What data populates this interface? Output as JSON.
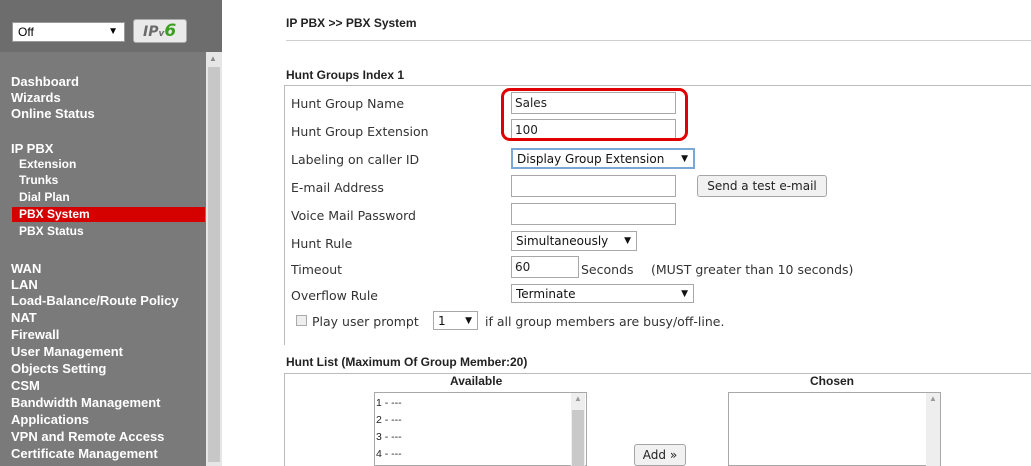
{
  "sidebar": {
    "mode_select": "Off",
    "ipv6_badge": {
      "prefix": "IP",
      "sub": "v",
      "num": "6"
    },
    "menu": [
      {
        "label": "Dashboard",
        "level": 1
      },
      {
        "label": "Wizards",
        "level": 1
      },
      {
        "label": "Online Status",
        "level": 1
      },
      {
        "label": "IP PBX",
        "level": 1
      },
      {
        "label": "Extension",
        "level": 2
      },
      {
        "label": "Trunks",
        "level": 2
      },
      {
        "label": "Dial Plan",
        "level": 2
      },
      {
        "label": "PBX System",
        "level": 2,
        "active": true
      },
      {
        "label": "PBX Status",
        "level": 2
      },
      {
        "label": "WAN",
        "level": 1
      },
      {
        "label": "LAN",
        "level": 1
      },
      {
        "label": "Load-Balance/Route Policy",
        "level": 1
      },
      {
        "label": "NAT",
        "level": 1
      },
      {
        "label": "Firewall",
        "level": 1
      },
      {
        "label": "User Management",
        "level": 1
      },
      {
        "label": "Objects Setting",
        "level": 1
      },
      {
        "label": "CSM",
        "level": 1
      },
      {
        "label": "Bandwidth Management",
        "level": 1
      },
      {
        "label": "Applications",
        "level": 1
      },
      {
        "label": "VPN and Remote Access",
        "level": 1
      },
      {
        "label": "Certificate Management",
        "level": 1
      }
    ]
  },
  "breadcrumb": "IP PBX >> PBX System",
  "section_title": "Hunt Groups Index 1",
  "form": {
    "group_name": {
      "label": "Hunt Group Name",
      "value": "Sales"
    },
    "group_extension": {
      "label": "Hunt Group Extension",
      "value": "100"
    },
    "labeling": {
      "label": "Labeling on caller ID",
      "value": "Display Group Extension"
    },
    "email": {
      "label": "E-mail Address",
      "value": "",
      "button": "Send a test e-mail"
    },
    "voicemail_password": {
      "label": "Voice Mail Password",
      "value": ""
    },
    "hunt_rule": {
      "label": "Hunt Rule",
      "value": "Simultaneously"
    },
    "timeout": {
      "label": "Timeout",
      "value": "60",
      "unit": "Seconds",
      "note": "(MUST greater than 10 seconds)"
    },
    "overflow_rule": {
      "label": "Overflow Rule",
      "value": "Terminate"
    },
    "play_prompt": {
      "text_before": "Play user prompt",
      "value": "1",
      "text_after": "if all group members are busy/off-line.",
      "checked": false
    }
  },
  "hunt_list": {
    "title": "Hunt List (Maximum Of Group Member:20)",
    "available_label": "Available",
    "chosen_label": "Chosen",
    "available_items": [
      "1 - ---",
      "2 - ---",
      "3 - ---",
      "4 - ---"
    ],
    "add_button": "Add »"
  },
  "colors": {
    "sidebar_bg": "#7a7a7a",
    "active_menu": "#d50000",
    "highlight": "#e00000"
  }
}
